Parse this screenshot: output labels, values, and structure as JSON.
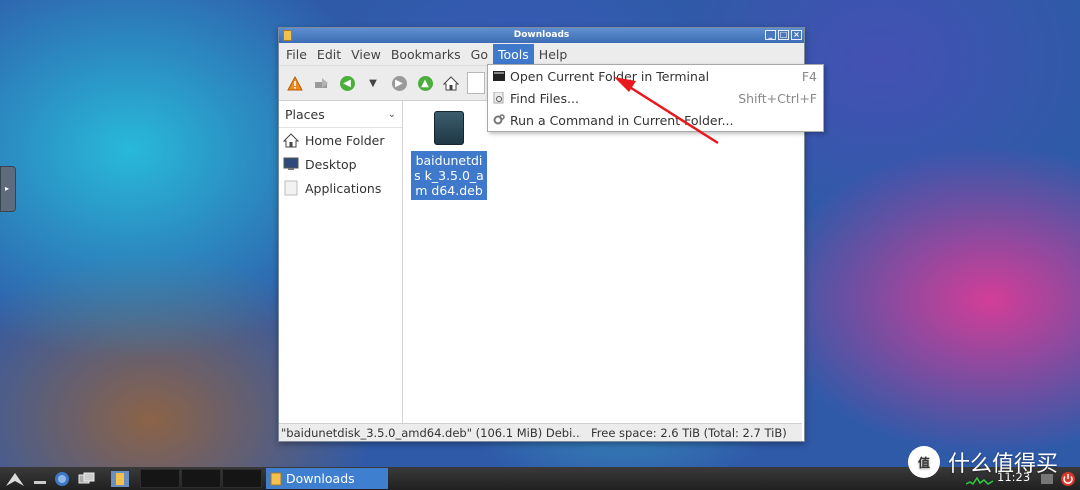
{
  "window": {
    "title": "Downloads",
    "buttons": [
      "_",
      "□",
      "×"
    ]
  },
  "menubar": {
    "items": [
      "File",
      "Edit",
      "View",
      "Bookmarks",
      "Go",
      "Tools",
      "Help"
    ],
    "active": "Tools"
  },
  "tools_menu": {
    "items": [
      {
        "label": "Open Current Folder in Terminal",
        "shortcut": "F4",
        "icon": "terminal-icon"
      },
      {
        "label": "Find Files...",
        "shortcut": "Shift+Ctrl+F",
        "icon": "find-icon"
      },
      {
        "label": "Run a Command in Current Folder...",
        "shortcut": "",
        "icon": "gears-icon"
      }
    ]
  },
  "sidebar": {
    "header": "Places",
    "items": [
      {
        "label": "Home Folder",
        "icon": "home-icon"
      },
      {
        "label": "Desktop",
        "icon": "desktop-icon"
      },
      {
        "label": "Applications",
        "icon": "applications-icon"
      }
    ]
  },
  "files": [
    {
      "name": "baidunetdisk_3.5.0_amd64.deb",
      "display": "baidunetdis k_3.5.0_am d64.deb",
      "icon": "deb-package-icon",
      "selected": true
    }
  ],
  "statusbar": {
    "selection": "\"baidunetdisk_3.5.0_amd64.deb\" (106.1 MiB) Debi...",
    "free_space": "Free space: 2.6 TiB (Total: 2.7 TiB)"
  },
  "taskbar": {
    "task_label": "Downloads",
    "clock": "11:23"
  },
  "watermark": {
    "text": "什么值得买",
    "logo_text": "值"
  },
  "colors": {
    "selection": "#3e79cc",
    "annotation_arrow": "#e8191d",
    "titlebar": "#4a78bd"
  }
}
